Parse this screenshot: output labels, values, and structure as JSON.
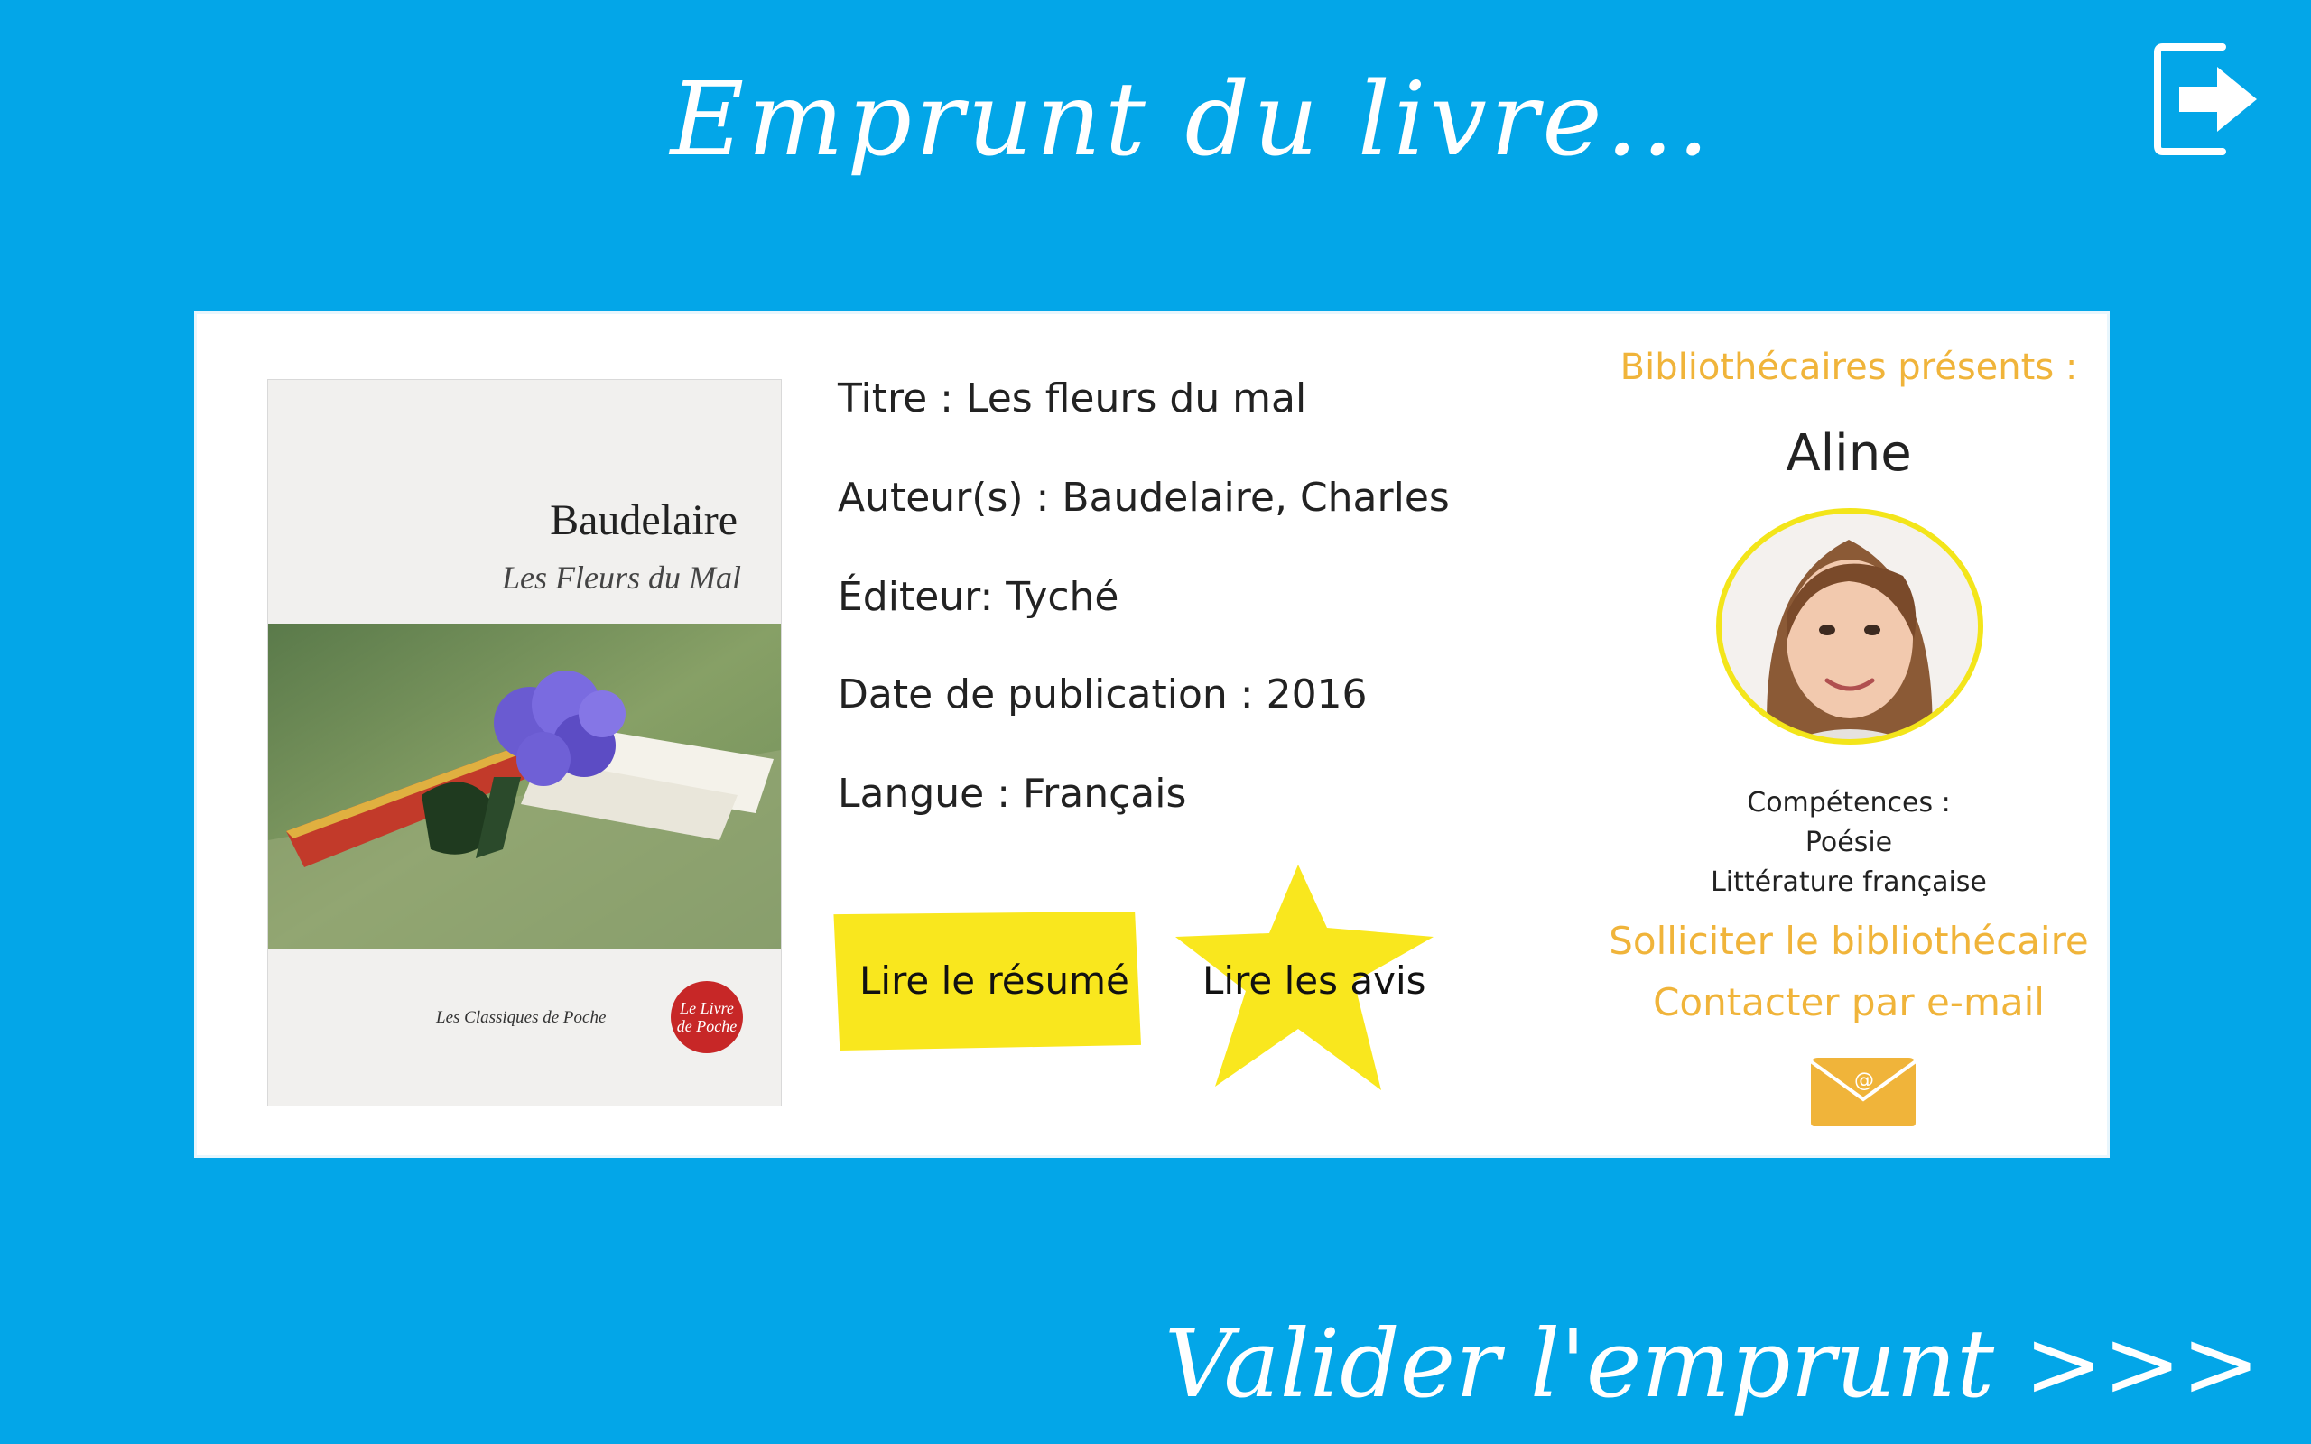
{
  "header": {
    "title": "Emprunt du livre..."
  },
  "book": {
    "cover": {
      "author": "Baudelaire",
      "title": "Les Fleurs du Mal",
      "series": "Les Classiques de Poche",
      "logo_text": "Le Livre de Poche"
    },
    "title_line": "Titre : Les fleurs du mal",
    "author_line": "Auteur(s) : Baudelaire, Charles",
    "publisher_line": "Éditeur: Tyché",
    "date_line": "Date de publication : 2016",
    "language_line": "Langue : Français"
  },
  "actions": {
    "read_summary": "Lire le résumé",
    "read_reviews": "Lire les avis"
  },
  "librarians": {
    "heading": "Bibliothécaires présents :",
    "name": "Aline",
    "skills_label": "Compétences :",
    "skills": [
      "Poésie",
      "Littérature française"
    ],
    "solicit": "Solliciter le bibliothécaire",
    "contact": "Contacter par e-mail"
  },
  "footer": {
    "validate": "Valider l'emprunt >>>"
  },
  "colors": {
    "background": "#03a6e8",
    "accent_yellow": "#f9e71e",
    "librarian_orange": "#f0b43a"
  },
  "icons": {
    "logout": "logout-icon",
    "mail": "mail-icon"
  }
}
